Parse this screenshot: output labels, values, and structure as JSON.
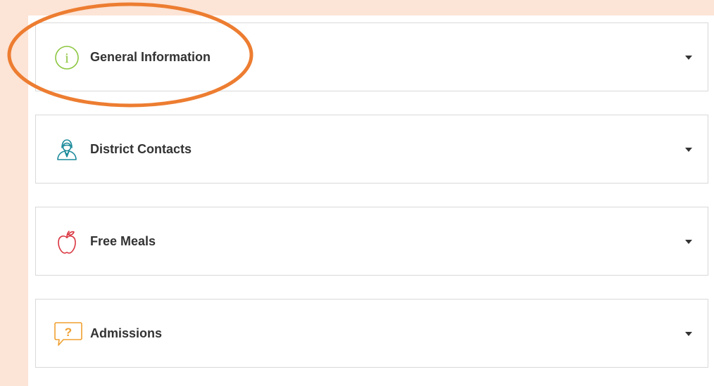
{
  "accordion": {
    "items": [
      {
        "label": "General Information",
        "icon": "info-circle-icon",
        "icon_color": "#8cc63f"
      },
      {
        "label": "District Contacts",
        "icon": "person-contact-icon",
        "icon_color": "#1b8a9a"
      },
      {
        "label": "Free Meals",
        "icon": "apple-icon",
        "icon_color": "#d9343f"
      },
      {
        "label": "Admissions",
        "icon": "question-bubble-icon",
        "icon_color": "#f0a030"
      }
    ]
  },
  "annotation": {
    "highlight_color": "#ed7d31"
  },
  "colors": {
    "page_background": "#fce4d6",
    "panel_background": "#ffffff",
    "border": "#d9d9d9",
    "label_text": "#333333"
  }
}
